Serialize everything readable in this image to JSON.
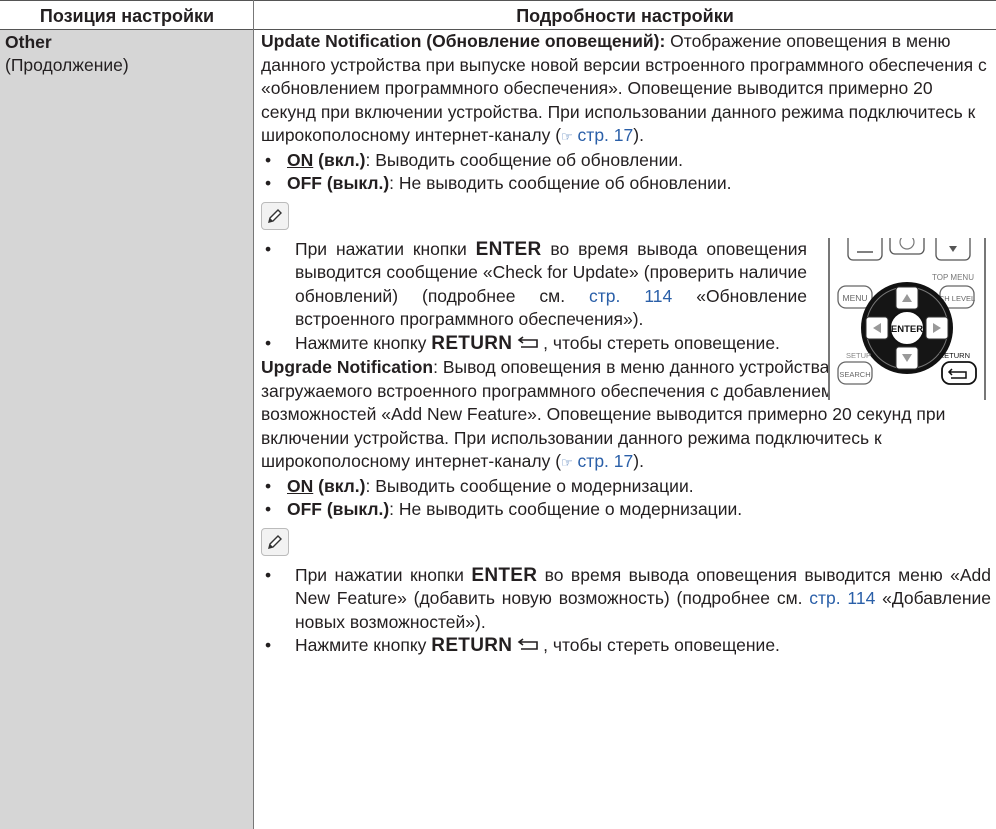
{
  "header": {
    "col1": "Позиция настройки",
    "col2": "Подробности настройки"
  },
  "left": {
    "item": "Other",
    "sub": "(Продолжение)"
  },
  "update": {
    "title": "Update Notification (Обновление оповещений):",
    "text": " Отображение оповещения в меню данного устройства при выпуске новой версии встроенного программного обеспечения с «обновлением программного обеспечения». Оповещение выводится примерно 20 секунд при включении устройства. При использовании данного режима подключитесь к широкополосному интернет-каналу (",
    "ref_icon": "☞",
    "ref": " стр. 17",
    "text_end": ").",
    "on_label": "ON",
    "on_suffix": " (вкл.)",
    "on_text": ": Выводить сообщение об обновлении.",
    "off_label": "OFF (выкл.)",
    "off_text": ": Не выводить сообщение об обновлении.",
    "note1_a": "При нажатии кнопки ",
    "note1_btn": "ENTER",
    "note1_b": " во время вывода оповещения выводится сообщение «Check for Update» (проверить наличие обновлений) (подробнее см. ",
    "note1_link": "стр. 114",
    "note1_c": " «Обновление встроенного программного обеспечения»).",
    "note2_a": "Нажмите кнопку ",
    "note2_btn": "RETURN",
    "note2_b": ", чтобы стереть оповещение."
  },
  "remote": {
    "menu": "MENU",
    "top_menu": "TOP MENU",
    "ch_level": "CH LEVEL",
    "enter": "ENTER",
    "setup": "SETUP",
    "search": "SEARCH",
    "return": "RETURN"
  },
  "upgrade": {
    "title": "Upgrade Notification",
    "text": ": Вывод оповещения в меню данного устройства при выпуске загружаемого встроенного программного обеспечения с добавлением новых возможностей «Add New Feature». Оповещение выводится примерно 20 секунд при включении устройства. При использовании данного режима подключитесь к широкополосному интернет-каналу (",
    "ref_icon": "☞",
    "ref": " стр. 17",
    "text_end": ").",
    "on_label": "ON",
    "on_suffix": " (вкл.)",
    "on_text": ": Выводить сообщение о модернизации.",
    "off_label": "OFF (выкл.)",
    "off_text": ": Не выводить сообщение о модернизации.",
    "note1_a": "При нажатии кнопки ",
    "note1_btn": "ENTER",
    "note1_b": " во время вывода оповещения выводится меню «Add New Feature» (добавить новую возможность) (подробнее см. ",
    "note1_link": "стр. 114",
    "note1_c": " «Добавление новых возможностей»).",
    "note2_a": "Нажмите кнопку ",
    "note2_btn": "RETURN",
    "note2_b": ", чтобы стереть оповещение."
  }
}
